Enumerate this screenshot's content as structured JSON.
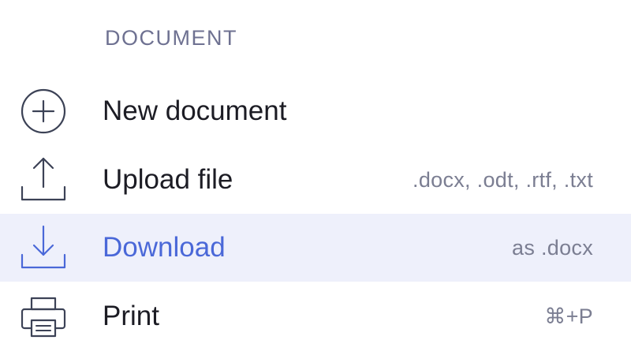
{
  "section": {
    "title": "DOCUMENT"
  },
  "items": [
    {
      "label": "New document",
      "hint": "",
      "icon": "plus-circle-icon",
      "active": false
    },
    {
      "label": "Upload file",
      "hint": ".docx, .odt, .rtf, .txt",
      "icon": "upload-icon",
      "active": false
    },
    {
      "label": "Download",
      "hint": "as .docx",
      "icon": "download-icon",
      "active": true
    },
    {
      "label": "Print",
      "hint": "⌘+P",
      "icon": "printer-icon",
      "active": false
    }
  ],
  "colors": {
    "accent": "#4a68d8",
    "active_background": "#eef0fb",
    "icon_stroke": "#3c4256",
    "header_text": "#6e7191",
    "hint_text": "#7b7e92",
    "label_text": "#1c1c24"
  }
}
